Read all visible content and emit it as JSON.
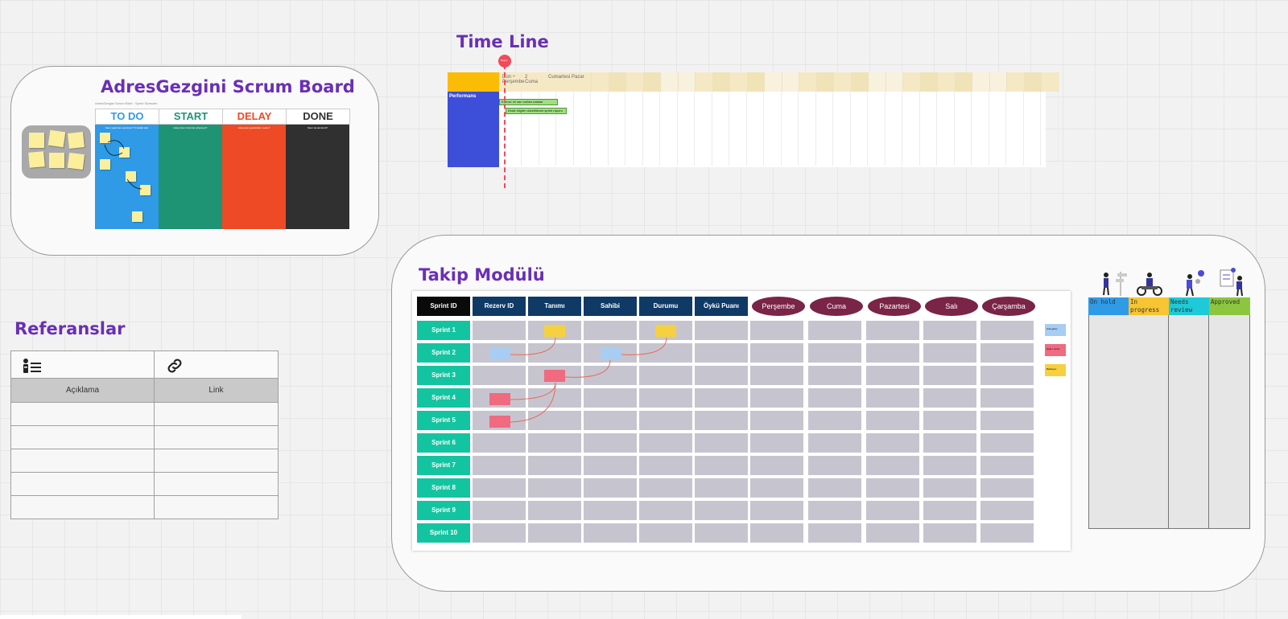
{
  "scrum_board": {
    "title": "AdresGezgini Scrum Board",
    "subtitle": "AdresGezgini Scrum Ekibi · Sprint Sürecleri",
    "columns": [
      {
        "label": "TO DO",
        "color": "#2f9ae6",
        "bg": "#2f9ae6",
        "question": "Neler yapılması gerekiyor? Sıradaki işler"
      },
      {
        "label": "START",
        "color": "#1e9474",
        "bg": "#1e9474",
        "question": "Hangi işler üzerinde çalışılıyor?"
      },
      {
        "label": "DELAY",
        "color": "#ee4a25",
        "bg": "#ee4a25",
        "question": "Hangi işler geciktirildi, neden?"
      },
      {
        "label": "DONE",
        "color": "#333333",
        "bg": "#303030",
        "question": "Neler tamamlandı?"
      }
    ]
  },
  "timeline": {
    "title": "Time Line",
    "marker_label": "Bugün",
    "days": [
      "Dün ÷ Perşembe",
      "2 Cuma",
      "Cumartesi",
      "Pazar"
    ],
    "row_label": "Performans",
    "bars": [
      "Kırmızı ve sarı nottan hatalar",
      "Eksik bilgiler düzeltilecek sprint raporu"
    ]
  },
  "takip": {
    "title": "Takip Modülü",
    "sprint_header": "Sprint ID",
    "headers": [
      "Rezerv ID",
      "Tanımı",
      "Sahibi",
      "Durumu",
      "Öykü Puanı"
    ],
    "days": [
      "Perşembe",
      "Cuma",
      "Pazartesi",
      "Salı",
      "Çarşamba"
    ],
    "sprints": [
      "Sprint 1",
      "Sprint 2",
      "Sprint 3",
      "Sprint 4",
      "Sprint 5",
      "Sprint 6",
      "Sprint 7",
      "Sprint 8",
      "Sprint 9",
      "Sprint 10"
    ],
    "legend_notes": [
      {
        "label": "Ana görev",
        "color": "#a7cdf3"
      },
      {
        "label": "Hata / sorun",
        "color": "#f06a80"
      },
      {
        "label": "Bekleyen",
        "color": "#f6d13f"
      }
    ]
  },
  "kanban": {
    "columns": [
      {
        "label": "On hold",
        "color": "#2f9ae6"
      },
      {
        "label": "In progress",
        "color": "#f7c531"
      },
      {
        "label": "Needs review",
        "color": "#1ecad8"
      },
      {
        "label": "Approved",
        "color": "#8cc63f"
      }
    ]
  },
  "referanslar": {
    "title": "Referanslar",
    "col_description": "Açıklama",
    "col_link": "Link",
    "info_icon": "info-list-icon",
    "link_icon": "link-icon"
  }
}
